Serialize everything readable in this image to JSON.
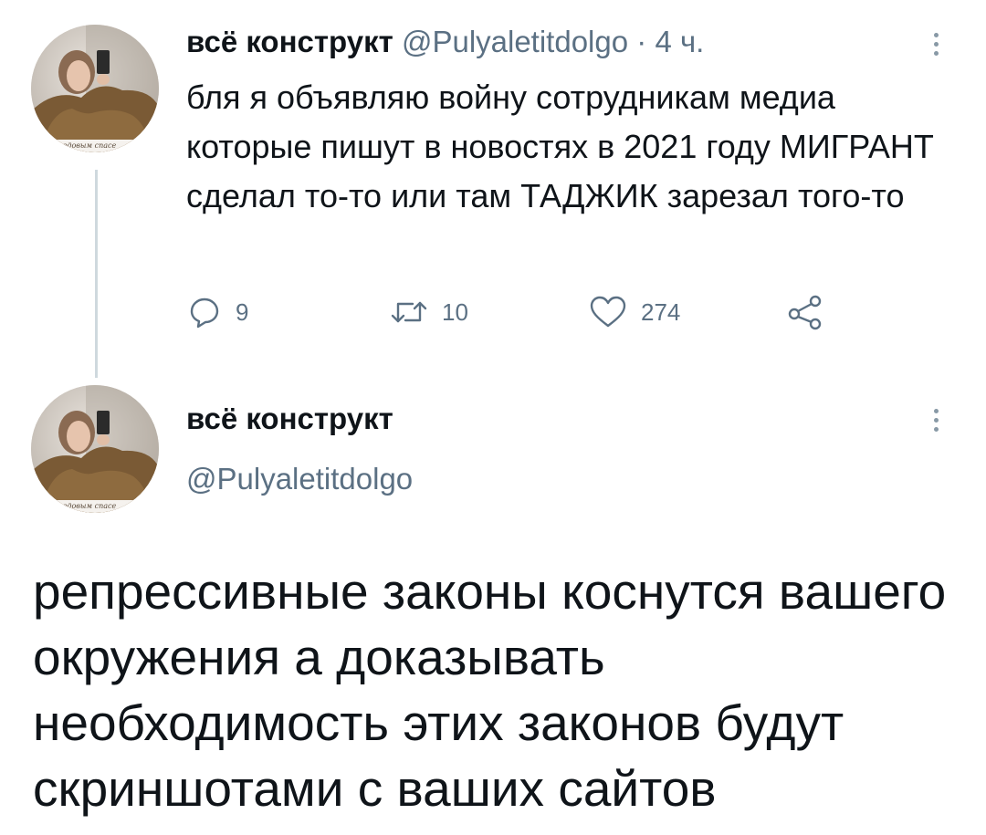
{
  "tweet1": {
    "display_name": "всё конструкт",
    "handle": "@Pulyaletitdolgo",
    "time": " · 4 ч.",
    "text": "бля я объявляю войну сотрудникам медиа которые пишут в новостях в 2021 году МИГРАНТ сделал то-то или там ТАДЖИК зарезал того-то",
    "actions": {
      "reply_count": "9",
      "retweet_count": "10",
      "like_count": "274"
    },
    "avatar_caption": "медовым спасе"
  },
  "tweet2": {
    "display_name": "всё конструкт",
    "handle": "@Pulyaletitdolgo",
    "text": "репрессивные законы коснутся вашего окружения а доказывать необходимость этих законов будут скриншотами с ваших сайтов",
    "avatar_caption": "медовым спасе"
  },
  "icons": {
    "reply": "reply-icon",
    "retweet": "retweet-icon",
    "like": "heart-icon",
    "share": "share-icon",
    "more": "more-vertical-icon"
  },
  "colors": {
    "text": "#0f1419",
    "secondary": "#5b7083",
    "thread_line": "#cfd9de"
  }
}
